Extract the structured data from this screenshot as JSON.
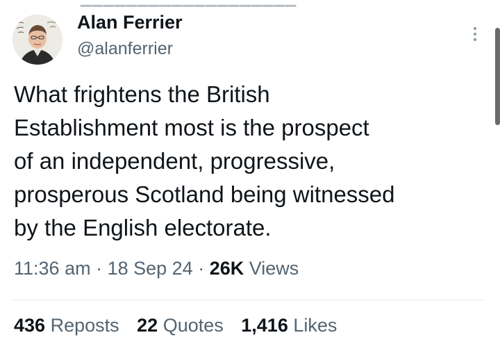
{
  "author": {
    "name": "Alan Ferrier",
    "handle": "@alanferrier"
  },
  "icons": {
    "more": "more-options-icon",
    "avatar": "profile-photo"
  },
  "tweet": {
    "lines": [
      "What frightens the British",
      "Establishment most is the prospect",
      "of an independent, progressive,",
      "prosperous Scotland being witnessed",
      "by the English electorate."
    ]
  },
  "meta": {
    "time": "11:36 am",
    "sep1": " · ",
    "date": "18 Sep 24",
    "sep2": " · ",
    "views_count": "26K",
    "views_label": " Views"
  },
  "stats": {
    "reposts_count": "436",
    "reposts_label": " Reposts",
    "quotes_count": "22",
    "quotes_label": " Quotes",
    "likes_count": "1,416",
    "likes_label": " Likes"
  },
  "colors": {
    "primary_text": "#0f1419",
    "secondary_text": "#536471",
    "divider": "#e3e7ea"
  }
}
